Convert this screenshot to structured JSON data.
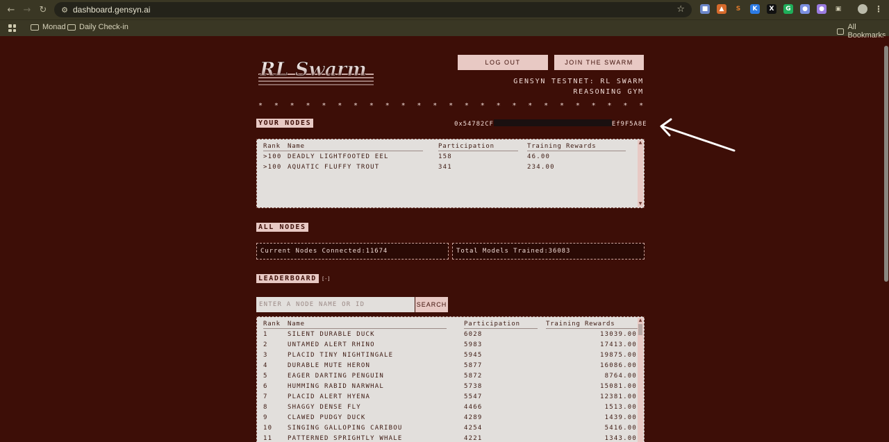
{
  "browser": {
    "url": "dashboard.gensyn.ai",
    "bookmarks": [
      "Monad",
      "Daily Check-in"
    ],
    "all_bookmarks_label": "All Bookmarks"
  },
  "header": {
    "logo_text": "RL Swarm",
    "logout_label": "LOG OUT",
    "join_label": "JOIN THE SWARM",
    "network_line1": "GENSYN TESTNET: RL SWARM",
    "network_line2": "REASONING GYM",
    "stars": "* * * * * * * * * * * * * * * * * * * * * * * * * * * * * * * * * * * * * * *"
  },
  "your_nodes": {
    "label": "YOUR NODES",
    "address_prefix": "0x54782CF",
    "address_suffix": "Ef9F5A8E",
    "columns": [
      "Rank",
      "Name",
      "Participation",
      "Training Rewards"
    ],
    "rows": [
      {
        "rank": ">100",
        "name": "DEADLY LIGHTFOOTED EEL",
        "participation": "158",
        "rewards": "46.00"
      },
      {
        "rank": ">100",
        "name": "AQUATIC FLUFFY TROUT",
        "participation": "341",
        "rewards": "234.00"
      }
    ]
  },
  "all_nodes": {
    "label": "ALL NODES",
    "current_nodes": "Current Nodes Connected:11674",
    "total_models": "Total Models Trained:36083"
  },
  "leaderboard": {
    "label": "LEADERBOARD",
    "toggle": "[-]",
    "search_placeholder": "ENTER A NODE NAME OR ID",
    "search_label": "SEARCH",
    "columns": [
      "Rank",
      "Name",
      "Participation",
      "Training Rewards"
    ],
    "rows": [
      {
        "rank": "1",
        "name": "SILENT DURABLE DUCK",
        "participation": "6028",
        "rewards": "13039.00"
      },
      {
        "rank": "2",
        "name": "UNTAMED ALERT RHINO",
        "participation": "5983",
        "rewards": "17413.00"
      },
      {
        "rank": "3",
        "name": "PLACID TINY NIGHTINGALE",
        "participation": "5945",
        "rewards": "19875.00"
      },
      {
        "rank": "4",
        "name": "DURABLE MUTE HERON",
        "participation": "5877",
        "rewards": "16086.00"
      },
      {
        "rank": "5",
        "name": "EAGER DARTING PENGUIN",
        "participation": "5872",
        "rewards": "8764.00"
      },
      {
        "rank": "6",
        "name": "HUMMING RABID NARWHAL",
        "participation": "5738",
        "rewards": "15081.00"
      },
      {
        "rank": "7",
        "name": "PLACID ALERT HYENA",
        "participation": "5547",
        "rewards": "12381.00"
      },
      {
        "rank": "8",
        "name": "SHAGGY DENSE FLY",
        "participation": "4466",
        "rewards": "1513.00"
      },
      {
        "rank": "9",
        "name": "CLAWED PUDGY DUCK",
        "participation": "4289",
        "rewards": "1439.00"
      },
      {
        "rank": "10",
        "name": "SINGING GALLOPING CARIBOU",
        "participation": "4254",
        "rewards": "5416.00"
      },
      {
        "rank": "11",
        "name": "PATTERNED SPRIGHTLY WHALE",
        "participation": "4221",
        "rewards": "1343.00"
      }
    ]
  }
}
